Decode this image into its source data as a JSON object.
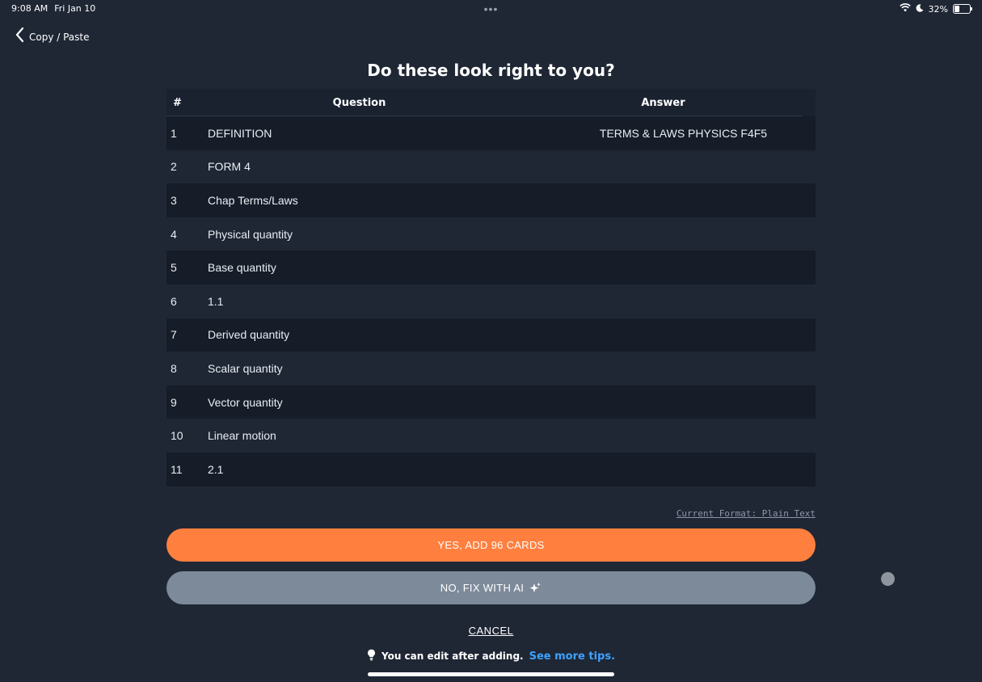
{
  "status_bar": {
    "time": "9:08 AM",
    "date": "Fri Jan 10",
    "battery_text": "32%",
    "battery_level": 0.32
  },
  "nav": {
    "back_label": "Copy / Paste"
  },
  "page": {
    "title": "Do these look right to you?"
  },
  "table": {
    "headers": {
      "num": "#",
      "question": "Question",
      "answer": "Answer"
    },
    "rows": [
      {
        "num": "1",
        "question": "DEFINITION",
        "answer": "TERMS & LAWS PHYSICS F4F5"
      },
      {
        "num": "2",
        "question": "FORM 4",
        "answer": ""
      },
      {
        "num": "3",
        "question": "Chap Terms/Laws",
        "answer": ""
      },
      {
        "num": "4",
        "question": "Physical quantity",
        "answer": ""
      },
      {
        "num": "5",
        "question": "Base quantity",
        "answer": ""
      },
      {
        "num": "6",
        "question": "1.1",
        "answer": ""
      },
      {
        "num": "7",
        "question": "Derived quantity",
        "answer": ""
      },
      {
        "num": "8",
        "question": "Scalar quantity",
        "answer": ""
      },
      {
        "num": "9",
        "question": "Vector quantity",
        "answer": ""
      },
      {
        "num": "10",
        "question": "Linear motion",
        "answer": ""
      },
      {
        "num": "11",
        "question": "2.1",
        "answer": ""
      }
    ]
  },
  "format_link": "Current Format: Plain Text",
  "buttons": {
    "yes_label": "YES, ADD 96 CARDS",
    "no_label": "NO, FIX WITH AI",
    "cancel_label": "CANCEL"
  },
  "tip": {
    "text": "You can edit after adding.",
    "link": "See more tips."
  },
  "colors": {
    "background": "#1f2735",
    "primary": "#ff7f3f",
    "secondary": "#7d8a9a",
    "link": "#3ea2ff"
  }
}
